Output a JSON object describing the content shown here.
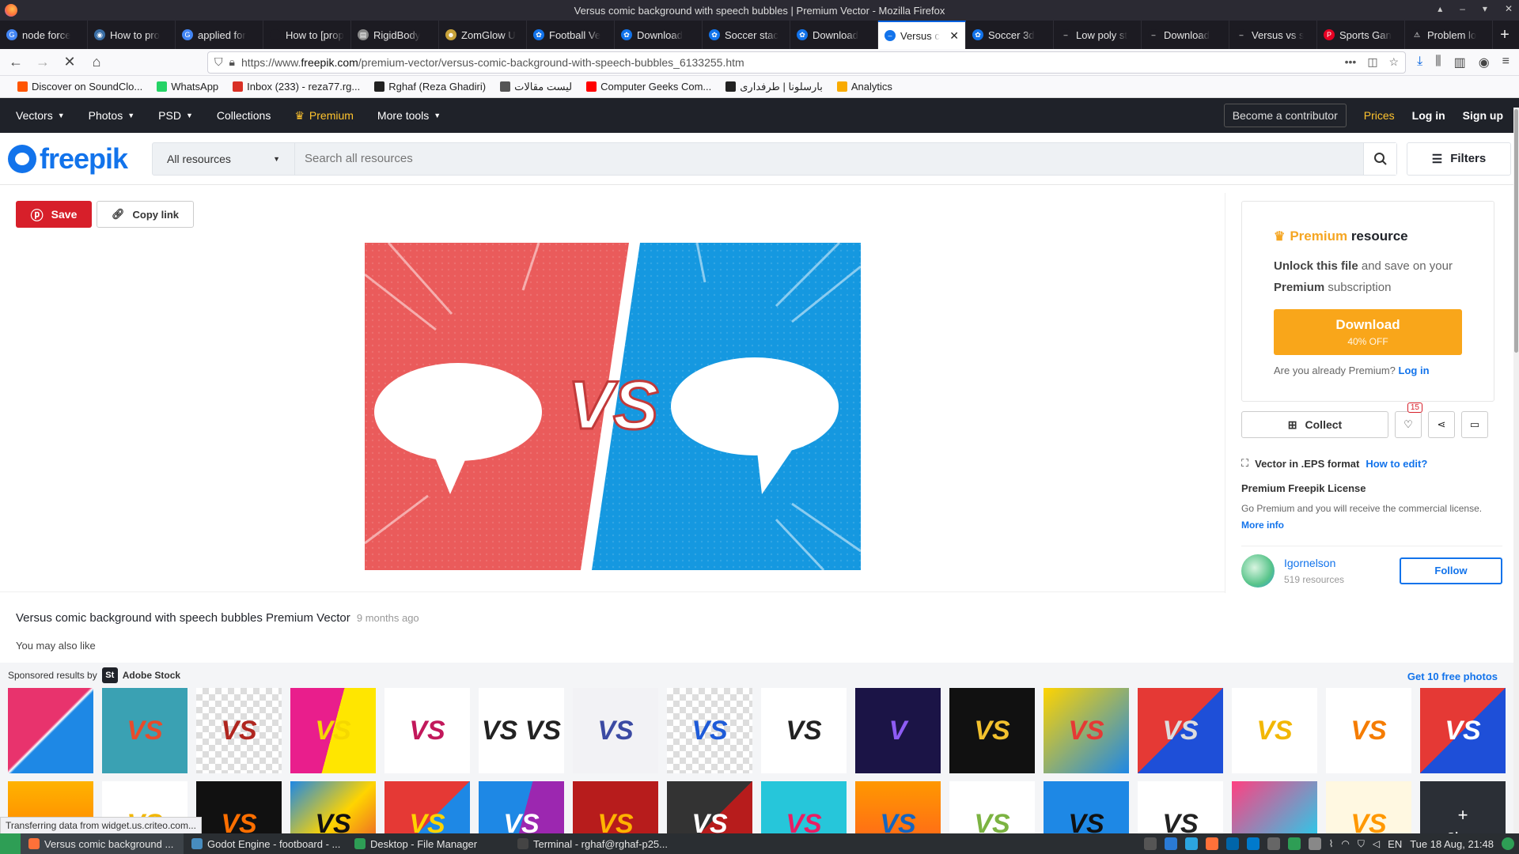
{
  "window": {
    "title": "Versus comic background with speech bubbles | Premium Vector - Mozilla Firefox",
    "controls": [
      "▴",
      "–",
      "▾",
      "✕"
    ]
  },
  "tabs": [
    {
      "label": "node force",
      "color": "#4285f4",
      "glyph": "G"
    },
    {
      "label": "How to pro",
      "color": "#3a6ea5",
      "glyph": "◉"
    },
    {
      "label": "applied for",
      "color": "#4285f4",
      "glyph": "G"
    },
    {
      "label": "How to [proper",
      "color": "#1c1b22",
      "glyph": ""
    },
    {
      "label": "RigidBody",
      "color": "#888888",
      "glyph": "▤"
    },
    {
      "label": "ZomGlow U",
      "color": "#c8a23a",
      "glyph": "☻"
    },
    {
      "label": "Football Ve",
      "color": "#1273eb",
      "glyph": "✿"
    },
    {
      "label": "Download",
      "color": "#1273eb",
      "glyph": "✿"
    },
    {
      "label": "Soccer stac",
      "color": "#1273eb",
      "glyph": "✿"
    },
    {
      "label": "Download",
      "color": "#1273eb",
      "glyph": "✿"
    },
    {
      "label": "Versus c",
      "color": "#1273eb",
      "glyph": "–",
      "active": true
    },
    {
      "label": "Soccer 3d",
      "color": "#1273eb",
      "glyph": "✿"
    },
    {
      "label": "Low poly st",
      "color": "#1c1b22",
      "glyph": "–"
    },
    {
      "label": "Download",
      "color": "#1c1b22",
      "glyph": "–"
    },
    {
      "label": "Versus vs s",
      "color": "#1c1b22",
      "glyph": "–"
    },
    {
      "label": "Sports Gan",
      "color": "#e60023",
      "glyph": "P"
    },
    {
      "label": "Problem lo",
      "color": "#1c1b22",
      "glyph": "⚠"
    }
  ],
  "nav": {
    "url_prefix": "https://www.",
    "url_host": "freepik.com",
    "url_path": "/premium-vector/versus-comic-background-with-speech-bubbles_6133255.htm"
  },
  "bookmarks": [
    {
      "label": "Discover on SoundClo...",
      "color": "#ff5500"
    },
    {
      "label": "WhatsApp",
      "color": "#25d366"
    },
    {
      "label": "Inbox (233) - reza77.rg...",
      "color": "#d93025"
    },
    {
      "label": "Rghaf (Reza Ghadiri)",
      "color": "#222222"
    },
    {
      "label": "لیست مقالات",
      "color": "#555555"
    },
    {
      "label": "Computer Geeks Com...",
      "color": "#ff0000"
    },
    {
      "label": "بارسلونا | طرفداری",
      "color": "#222222"
    },
    {
      "label": "Analytics",
      "color": "#f9ab00"
    }
  ],
  "sitenav": {
    "items": [
      "Vectors",
      "Photos",
      "PSD",
      "Collections"
    ],
    "premium": "Premium",
    "more": "More tools",
    "contributor": "Become a contributor",
    "prices": "Prices",
    "login": "Log in",
    "signup": "Sign up"
  },
  "search": {
    "logo": "freepik",
    "category": "All resources",
    "placeholder": "Search all resources",
    "filters": "Filters"
  },
  "actions": {
    "save": "Save",
    "copy": "Copy link"
  },
  "preview": {
    "vs_text": "VS"
  },
  "meta": {
    "title": "Versus comic background with speech bubbles Premium Vector",
    "ago": "9 months ago",
    "also_like": "You may also like"
  },
  "premium": {
    "head_gold": "Premium",
    "head_rest": " resource",
    "line1_bold": "Unlock this file",
    "line1_rest": " and save on your ",
    "line2_bold": "Premium",
    "line2_rest": " subscription",
    "download": "Download",
    "discount": "40% OFF",
    "already": "Are you already Premium?",
    "login": "Log in"
  },
  "social": {
    "collect": "Collect",
    "likes": "15"
  },
  "format": {
    "label": "Vector in .EPS format",
    "how": "How to edit?"
  },
  "license": {
    "title": "Premium Freepik License",
    "desc": "Go Premium and you will receive the commercial license.",
    "more": "More info"
  },
  "author": {
    "name": "Igornelson",
    "resources": "519 resources",
    "follow": "Follow"
  },
  "sponsored": {
    "label": "Sponsored results by",
    "brand": "Adobe Stock",
    "brand_mark": "St",
    "getfree": "Get 10 free photos",
    "show": "Show",
    "row1": [
      {
        "bg": "linear-gradient(135deg,#e8336d 0%,#e8336d 48%,#fff 50%,#1e88e5 52%)",
        "text": ""
      },
      {
        "bg": "#3aa1b3",
        "text": "VS",
        "color": "#e84b2b"
      },
      {
        "bg": "repeating-conic-gradient(#ddd 0 25%,#fff 0 50%) 0 0/16px 16px",
        "text": "VS",
        "color": "#b0261f"
      },
      {
        "bg": "linear-gradient(105deg,#e91e8c 0%,#e91e8c 50%,#ffe600 50%)",
        "text": "VS",
        "color": "#f5d800"
      },
      {
        "bg": "#ffffff",
        "text": "VS",
        "color": "#c2185b"
      },
      {
        "bg": "#ffffff",
        "text": "VS VS",
        "color": "#222222"
      },
      {
        "bg": "#f2f2f5",
        "text": "VS",
        "color": "#3b4aa3"
      },
      {
        "bg": "repeating-conic-gradient(#ddd 0 25%,#fff 0 50%) 0 0/16px 16px",
        "text": "VS",
        "color": "#1e5bd8"
      },
      {
        "bg": "#ffffff",
        "text": "VS",
        "color": "#222222"
      },
      {
        "bg": "#1b1446",
        "text": "V",
        "color": "#8e5cf5"
      },
      {
        "bg": "#111111",
        "text": "VS",
        "color": "#f2c12e"
      },
      {
        "bg": "linear-gradient(135deg,#ffd400,#1e88e5)",
        "text": "VS",
        "color": "#e53935"
      },
      {
        "bg": "linear-gradient(135deg,#e53935 50%,#1e4fd8 50%)",
        "text": "VS",
        "color": "#dddddd"
      },
      {
        "bg": "#ffffff",
        "text": "VS",
        "color": "#f2b705"
      },
      {
        "bg": "#ffffff",
        "text": "VS",
        "color": "#f57c00"
      },
      {
        "bg": "linear-gradient(135deg,#e53935 50%,#1e4fd8 50%)",
        "text": "VS",
        "color": "#ffffff"
      }
    ],
    "row2": [
      {
        "bg": "linear-gradient(#ffb300,#ff6f00)",
        "text": "",
        "color": "#ffffff"
      },
      {
        "bg": "#ffffff",
        "text": "VS",
        "color": "#f2b705"
      },
      {
        "bg": "#111111",
        "text": "VS",
        "color": "#ff6f00"
      },
      {
        "bg": "linear-gradient(135deg,#1e88e5,#ffd400,#e53935)",
        "text": "VS",
        "color": "#111111"
      },
      {
        "bg": "linear-gradient(135deg,#e53935 50%,#1e88e5 50%)",
        "text": "VS",
        "color": "#ffd400"
      },
      {
        "bg": "linear-gradient(105deg,#1e88e5 50%,#9c27b0 50%)",
        "text": "VS",
        "color": "#ffffff"
      },
      {
        "bg": "#b71c1c",
        "text": "VS",
        "color": "#ffb300"
      },
      {
        "bg": "linear-gradient(135deg,#333 50%,#b71c1c 50%)",
        "text": "VS",
        "color": "#ffffff"
      },
      {
        "bg": "#26c6da",
        "text": "VS",
        "color": "#e91e63"
      },
      {
        "bg": "linear-gradient(#ff9800,#ff5722)",
        "text": "VS",
        "color": "#1565c0"
      },
      {
        "bg": "#ffffff",
        "text": "VS",
        "color": "#7cb342"
      },
      {
        "bg": "#1e88e5",
        "text": "VS",
        "color": "#111111"
      },
      {
        "bg": "#ffffff",
        "text": "VS",
        "color": "#222222"
      },
      {
        "bg": "linear-gradient(135deg,#ff4081,#00e5ff)",
        "text": "",
        "color": "#ffffff"
      },
      {
        "bg": "#fff8e1",
        "text": "VS",
        "color": "#ff9800"
      }
    ]
  },
  "status": "Transferring data from widget.us.criteo.com...",
  "taskbar": {
    "items": [
      {
        "label": "Versus comic background ...",
        "color": "#ff7139",
        "active": true
      },
      {
        "label": "Godot Engine - footboard - ...",
        "color": "#478cbf"
      },
      {
        "label": "Desktop - File Manager",
        "color": "#2e9e55"
      },
      {
        "label": "Terminal - rghaf@rghaf-p25...",
        "color": "#444444"
      }
    ],
    "lang": "EN",
    "clock": "Tue 18 Aug, 21:48"
  }
}
